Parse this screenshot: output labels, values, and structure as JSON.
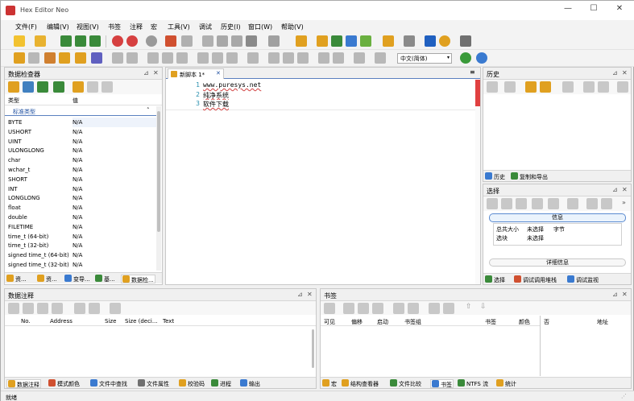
{
  "window": {
    "title": "Hex Editor Neo",
    "min": "—",
    "max": "☐",
    "close": "✕"
  },
  "menu": [
    "文件(F)",
    "编辑(V)",
    "视图(V)",
    "书签",
    "注释",
    "宏",
    "工具(V)",
    "调试",
    "历史(I)",
    "窗口(W)",
    "帮助(V)"
  ],
  "toolbar": {
    "language_select": "中文(简体)"
  },
  "inspector": {
    "title": "数据检查器",
    "col_type": "类型",
    "col_value": "值",
    "group": "标准类型",
    "rows": [
      {
        "type": "BYTE",
        "value": "N/A"
      },
      {
        "type": "USHORT",
        "value": "N/A"
      },
      {
        "type": "UINT",
        "value": "N/A"
      },
      {
        "type": "ULONGLONG",
        "value": "N/A"
      },
      {
        "type": "char",
        "value": "N/A"
      },
      {
        "type": "wchar_t",
        "value": "N/A"
      },
      {
        "type": "SHORT",
        "value": "N/A"
      },
      {
        "type": "INT",
        "value": "N/A"
      },
      {
        "type": "LONGLONG",
        "value": "N/A"
      },
      {
        "type": "float",
        "value": "N/A"
      },
      {
        "type": "double",
        "value": "N/A"
      },
      {
        "type": "FILETIME",
        "value": "N/A"
      },
      {
        "type": "time_t (64-bit)",
        "value": "N/A"
      },
      {
        "type": "time_t (32-bit)",
        "value": "N/A"
      },
      {
        "type": "signed time_t (64-bit)",
        "value": "N/A"
      },
      {
        "type": "signed time_t (32-bit)",
        "value": "N/A"
      }
    ],
    "tabs": [
      "资...",
      "资...",
      "变导...",
      "基...",
      "数据检..."
    ]
  },
  "editor": {
    "tab_label": "新脚本 1*",
    "tab_close": "✕",
    "lines": [
      {
        "num": "1",
        "text": "www.puresys.net"
      },
      {
        "num": "2",
        "text": "纯净系统"
      },
      {
        "num": "3",
        "text": "软件下载"
      }
    ]
  },
  "history": {
    "title": "历史",
    "tabs": [
      "历史",
      "复制和导出"
    ]
  },
  "selection": {
    "title": "选择",
    "info_header": "信息",
    "total_size_label": "总共大小",
    "total_size_value": "未选择",
    "total_size_unit": "字节",
    "mode_label": "选块",
    "mode_value": "未选择",
    "detail_header": "详细信息",
    "tabs": [
      "选择",
      "调试调用堆栈",
      "调试监视"
    ]
  },
  "annotations": {
    "title": "数据注释",
    "columns": [
      "No.",
      "Address",
      "Size",
      "Size (deci...",
      "Text"
    ],
    "tabs": [
      "数据注释",
      "模式颜色",
      "文件中查找",
      "文件属性",
      "校验码",
      "进程",
      "输出"
    ]
  },
  "bookmarks": {
    "title": "书签",
    "columns": [
      "可见",
      "偏移",
      "启动",
      "书签组",
      "书签",
      "颜色",
      "否",
      "地址"
    ],
    "tabs": [
      "宏",
      "结构查看器",
      "文件比较",
      "书签",
      "NTFS 流",
      "统计"
    ]
  },
  "status": {
    "text": "就绪"
  }
}
